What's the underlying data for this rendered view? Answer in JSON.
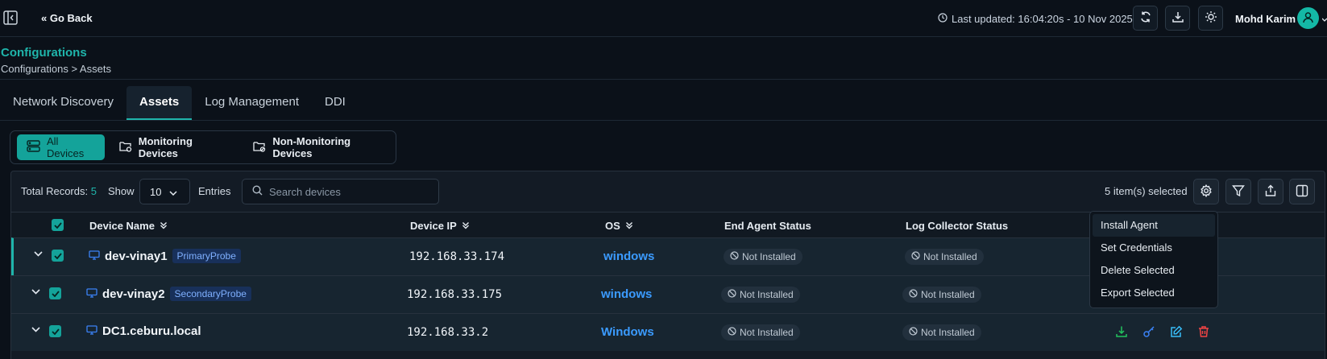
{
  "topbar": {
    "go_back": "« Go Back",
    "last_updated": "Last updated: 16:04:20s - 10 Nov 2025",
    "user_name": "Mohd Karim",
    "icons": [
      "sidebar-toggle-icon",
      "refresh-icon",
      "download-icon",
      "sun-icon",
      "user-icon"
    ]
  },
  "header": {
    "title": "Configurations",
    "breadcrumb": "Configurations > Assets"
  },
  "tabs": [
    {
      "label": "Network Discovery",
      "active": false
    },
    {
      "label": "Assets",
      "active": true
    },
    {
      "label": "Log Management",
      "active": false
    },
    {
      "label": "DDI",
      "active": false
    }
  ],
  "segments": [
    {
      "label": "All Devices",
      "active": true
    },
    {
      "label": "Monitoring Devices",
      "active": false
    },
    {
      "label": "Non-Monitoring Devices",
      "active": false
    }
  ],
  "toolbar": {
    "total_label": "Total Records:",
    "total_count": "5",
    "show_label": "Show",
    "entries_value": "10",
    "entries_label": "Entries",
    "search_placeholder": "Search devices",
    "selected_text": "5 item(s) selected"
  },
  "table": {
    "headers": {
      "device_name": "Device Name",
      "device_ip": "Device IP",
      "os": "OS",
      "end_agent_status": "End Agent Status",
      "log_collector_status": "Log Collector Status"
    },
    "rows": [
      {
        "name": "dev-vinay1",
        "probe": "PrimaryProbe",
        "ip": "192.168.33.174",
        "os": "windows",
        "agent_status": "Not Installed",
        "collector_status": "Not Installed"
      },
      {
        "name": "dev-vinay2",
        "probe": "SecondaryProbe",
        "ip": "192.168.33.175",
        "os": "windows",
        "agent_status": "Not Installed",
        "collector_status": "Not Installed"
      },
      {
        "name": "DC1.ceburu.local",
        "probe": "",
        "ip": "192.168.33.2",
        "os": "Windows",
        "agent_status": "Not Installed",
        "collector_status": "Not Installed"
      }
    ]
  },
  "bulk_menu": {
    "items": [
      "Install Agent",
      "Set Credentials",
      "Delete Selected",
      "Export Selected"
    ]
  },
  "colors": {
    "accent": "#14a39a",
    "background": "#0b1119",
    "os_link": "#3b9bff",
    "install_icon": "#22c55e",
    "key_icon": "#3b82f6",
    "edit_icon": "#38bdf8",
    "delete_icon": "#ef4444"
  }
}
